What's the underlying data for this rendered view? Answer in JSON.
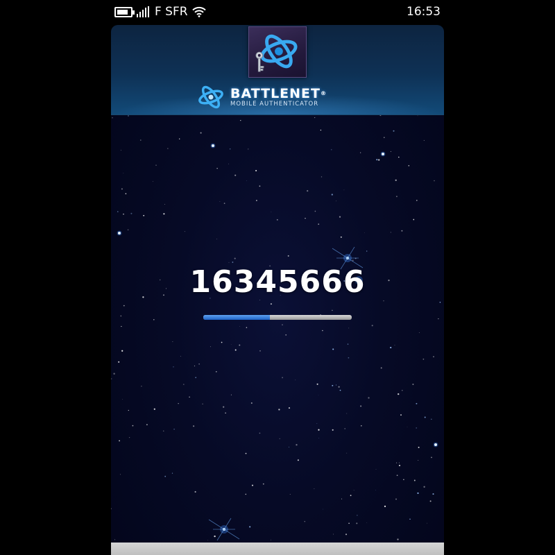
{
  "status_bar": {
    "carrier": "F SFR",
    "time": "16:53",
    "battery_level": 0.85,
    "icons": [
      "battery-icon",
      "signal-icon",
      "wifi-icon"
    ]
  },
  "header": {
    "brand_title": "BATTLENET",
    "brand_mark": "®",
    "brand_subtitle": "MOBILE AUTHENTICATOR",
    "icons": [
      "battlenet-key-icon",
      "battlenet-logo-icon"
    ]
  },
  "authenticator": {
    "code": "16345666",
    "time_progress": 0.45
  },
  "colors": {
    "accent": "#1e63c7",
    "background": "#060a26",
    "header": "#0e3155"
  }
}
